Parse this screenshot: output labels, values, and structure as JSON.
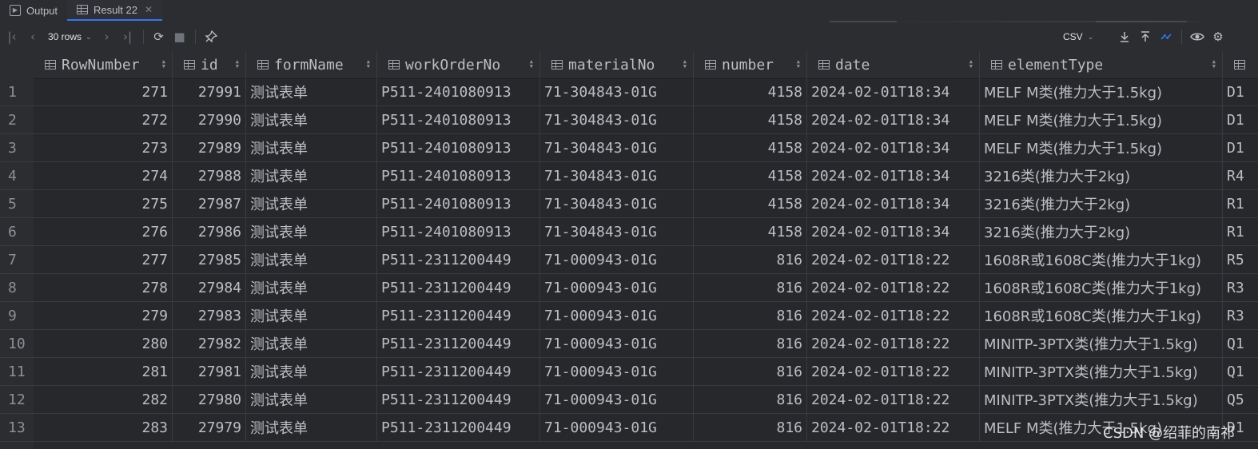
{
  "tabs": [
    {
      "label": "Output",
      "icon": "terminal-icon",
      "active": false
    },
    {
      "label": "Result 22",
      "icon": "table-icon",
      "active": true,
      "close": "✕"
    }
  ],
  "toolbar": {
    "rows_label": "30 rows",
    "export_format": "CSV"
  },
  "columns": [
    {
      "label": "RowNumber",
      "align": "right"
    },
    {
      "label": "id",
      "align": "right"
    },
    {
      "label": "formName",
      "align": "left"
    },
    {
      "label": "workOrderNo",
      "align": "left"
    },
    {
      "label": "materialNo",
      "align": "left"
    },
    {
      "label": "number",
      "align": "right"
    },
    {
      "label": "date",
      "align": "left"
    },
    {
      "label": "elementType",
      "align": "left"
    },
    {
      "label": "",
      "align": "left"
    }
  ],
  "rows": [
    {
      "n": "1",
      "cells": [
        "271",
        "27991",
        "测试表单",
        "P511-2401080913",
        "71-304843-01G",
        "4158",
        "2024-02-01T18:34",
        "MELF M类(推力大于1.5kg)",
        "D1"
      ]
    },
    {
      "n": "2",
      "cells": [
        "272",
        "27990",
        "测试表单",
        "P511-2401080913",
        "71-304843-01G",
        "4158",
        "2024-02-01T18:34",
        "MELF M类(推力大于1.5kg)",
        "D1"
      ]
    },
    {
      "n": "3",
      "cells": [
        "273",
        "27989",
        "测试表单",
        "P511-2401080913",
        "71-304843-01G",
        "4158",
        "2024-02-01T18:34",
        "MELF M类(推力大于1.5kg)",
        "D1"
      ]
    },
    {
      "n": "4",
      "cells": [
        "274",
        "27988",
        "测试表单",
        "P511-2401080913",
        "71-304843-01G",
        "4158",
        "2024-02-01T18:34",
        "3216类(推力大于2kg)",
        "R4"
      ]
    },
    {
      "n": "5",
      "cells": [
        "275",
        "27987",
        "测试表单",
        "P511-2401080913",
        "71-304843-01G",
        "4158",
        "2024-02-01T18:34",
        "3216类(推力大于2kg)",
        "R1"
      ]
    },
    {
      "n": "6",
      "cells": [
        "276",
        "27986",
        "测试表单",
        "P511-2401080913",
        "71-304843-01G",
        "4158",
        "2024-02-01T18:34",
        "3216类(推力大于2kg)",
        "R1"
      ]
    },
    {
      "n": "7",
      "cells": [
        "277",
        "27985",
        "测试表单",
        "P511-2311200449",
        "71-000943-01G",
        "816",
        "2024-02-01T18:22",
        "1608R或1608C类(推力大于1kg)",
        "R5"
      ]
    },
    {
      "n": "8",
      "cells": [
        "278",
        "27984",
        "测试表单",
        "P511-2311200449",
        "71-000943-01G",
        "816",
        "2024-02-01T18:22",
        "1608R或1608C类(推力大于1kg)",
        "R3"
      ]
    },
    {
      "n": "9",
      "cells": [
        "279",
        "27983",
        "测试表单",
        "P511-2311200449",
        "71-000943-01G",
        "816",
        "2024-02-01T18:22",
        "1608R或1608C类(推力大于1kg)",
        "R3"
      ]
    },
    {
      "n": "10",
      "cells": [
        "280",
        "27982",
        "测试表单",
        "P511-2311200449",
        "71-000943-01G",
        "816",
        "2024-02-01T18:22",
        "MINITP-3PTX类(推力大于1.5kg)",
        "Q1"
      ]
    },
    {
      "n": "11",
      "cells": [
        "281",
        "27981",
        "测试表单",
        "P511-2311200449",
        "71-000943-01G",
        "816",
        "2024-02-01T18:22",
        "MINITP-3PTX类(推力大于1.5kg)",
        "Q1"
      ]
    },
    {
      "n": "12",
      "cells": [
        "282",
        "27980",
        "测试表单",
        "P511-2311200449",
        "71-000943-01G",
        "816",
        "2024-02-01T18:22",
        "MINITP-3PTX类(推力大于1.5kg)",
        "Q5"
      ]
    },
    {
      "n": "13",
      "cells": [
        "283",
        "27979",
        "测试表单",
        "P511-2311200449",
        "71-000943-01G",
        "816",
        "2024-02-01T18:22",
        "MELF M类(推力大于1.5kg)",
        "D1"
      ]
    }
  ],
  "watermark": "CSDN @绍菲的南祁",
  "colors": {
    "accent": "#3574f0",
    "background": "#2b2d30",
    "text": "#bcbec4"
  }
}
